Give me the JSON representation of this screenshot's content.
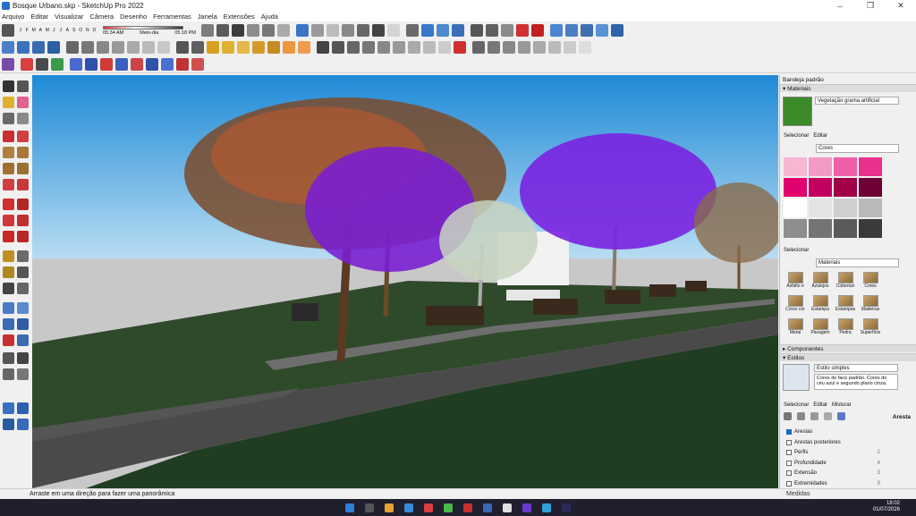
{
  "window": {
    "title": "Bosque Urbano.skp - SketchUp Pro 2022",
    "minimize": "–",
    "maximize": "❐",
    "close": "✕"
  },
  "menu": [
    "Arquivo",
    "Editar",
    "Visualizar",
    "Câmera",
    "Desenho",
    "Ferramentas",
    "Janela",
    "Extensões",
    "Ajuda"
  ],
  "shadow": {
    "months": [
      "J",
      "F",
      "M",
      "A",
      "M",
      "J",
      "J",
      "A",
      "S",
      "O",
      "N",
      "D"
    ],
    "time_start": "05:34 AM",
    "time_mid": "Meio-dia",
    "time_end": "05:18 PM"
  },
  "tray": {
    "title": "Bandeja padrão",
    "materials_section": "Materiais",
    "material_name": "Vegetação grama artificial",
    "tab_select": "Selecionar",
    "tab_edit": "Editar",
    "colors_dropdown": "Cores",
    "colors": [
      "#f7b6d2",
      "#f29ac4",
      "#ee5fa6",
      "#e8308d",
      "#e0006e",
      "#c4005e",
      "#a10049",
      "#6e0036",
      "#ffffff",
      "#e4e4e4",
      "#cfcfcf",
      "#b9b9b9",
      "#8e8e8e",
      "#747474",
      "#5a5a5a",
      "#3a3a3a"
    ],
    "select2": "Selecionar",
    "materials_dropdown": "Materiais",
    "material_categories": [
      "Asfalto e",
      "Azulejos",
      "Coberturi",
      "Cores",
      "Cores cor",
      "Estampa",
      "Estampas",
      "Madeiras",
      "Metal",
      "Pavagem",
      "Pedra",
      "Superfície"
    ],
    "components_section": "Componentes",
    "styles_section": "Estilos",
    "style_name": "Estilo simples",
    "style_desc": "Cores de face padrão. Cores do céu azul e segundo plano cinza.",
    "style_tabs": [
      "Selecionar",
      "Editar",
      "Misturar"
    ],
    "aresta_label": "Aresta",
    "edge_options": [
      {
        "label": "Arestas",
        "checked": true,
        "value": ""
      },
      {
        "label": "Arestas posteriores",
        "checked": false,
        "value": ""
      },
      {
        "label": "Perfis",
        "checked": false,
        "value": "2"
      },
      {
        "label": "Profundidade",
        "checked": false,
        "value": "4"
      },
      {
        "label": "Extensão",
        "checked": false,
        "value": "3"
      },
      {
        "label": "Extremidades",
        "checked": false,
        "value": "9"
      }
    ]
  },
  "status": {
    "hint": "Arraste em uma direção para fazer uma panorâmica",
    "measure_label": "Medidas"
  },
  "taskbar": {
    "time": "18:02",
    "date": "01/07/2026"
  }
}
